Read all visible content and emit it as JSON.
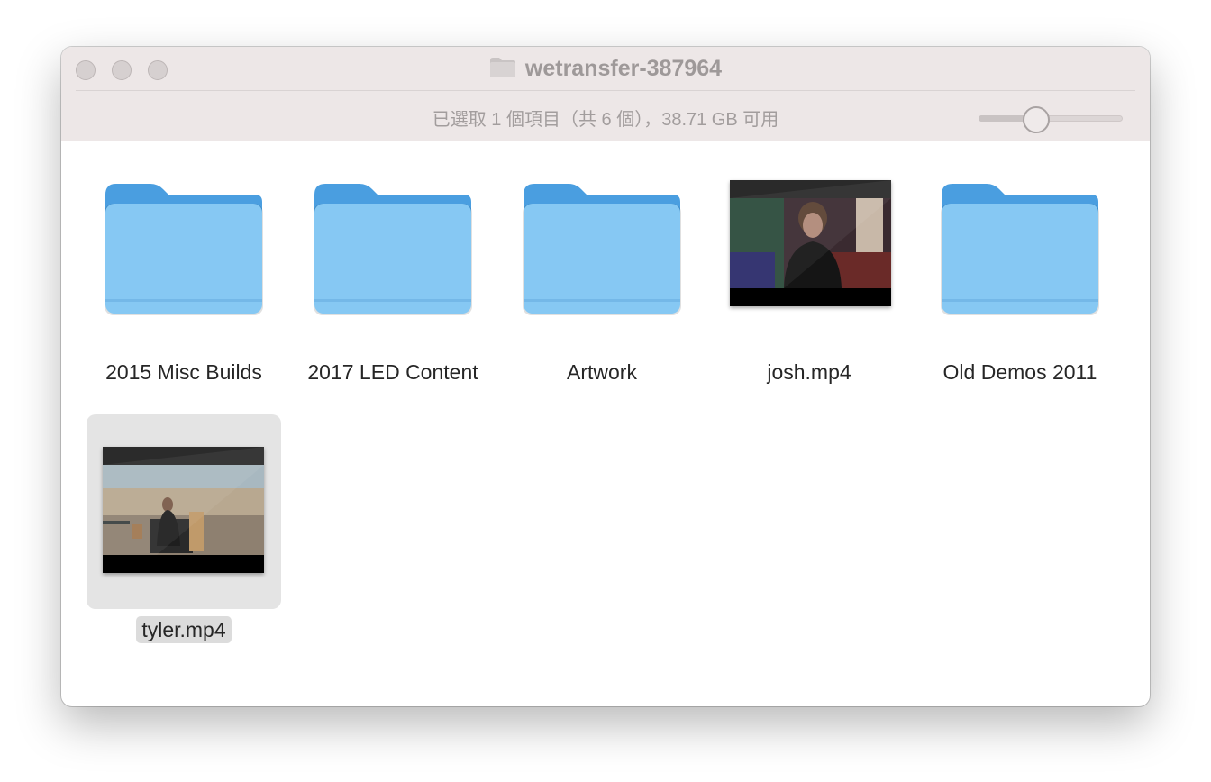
{
  "window": {
    "title": "wetransfer-387964",
    "status": "已選取 1 個項目（共 6 個），38.71 GB 可用",
    "icon_size_slider": 0.38,
    "traffic_lights": [
      "close",
      "minimize",
      "zoom"
    ]
  },
  "items": [
    {
      "name": "2015 Misc Builds",
      "kind": "folder",
      "selected": false
    },
    {
      "name": "2017 LED Content",
      "kind": "folder",
      "selected": false
    },
    {
      "name": "Artwork",
      "kind": "folder",
      "selected": false
    },
    {
      "name": "josh.mp4",
      "kind": "video",
      "selected": false
    },
    {
      "name": "Old Demos 2011",
      "kind": "folder",
      "selected": false
    },
    {
      "name": "tyler.mp4",
      "kind": "video",
      "selected": true
    }
  ],
  "colors": {
    "folder_front": "#86c8f3",
    "folder_back": "#4a9ee0",
    "selection_bg": "#e4e4e4",
    "titlebar_bg": "#ede7e7"
  }
}
